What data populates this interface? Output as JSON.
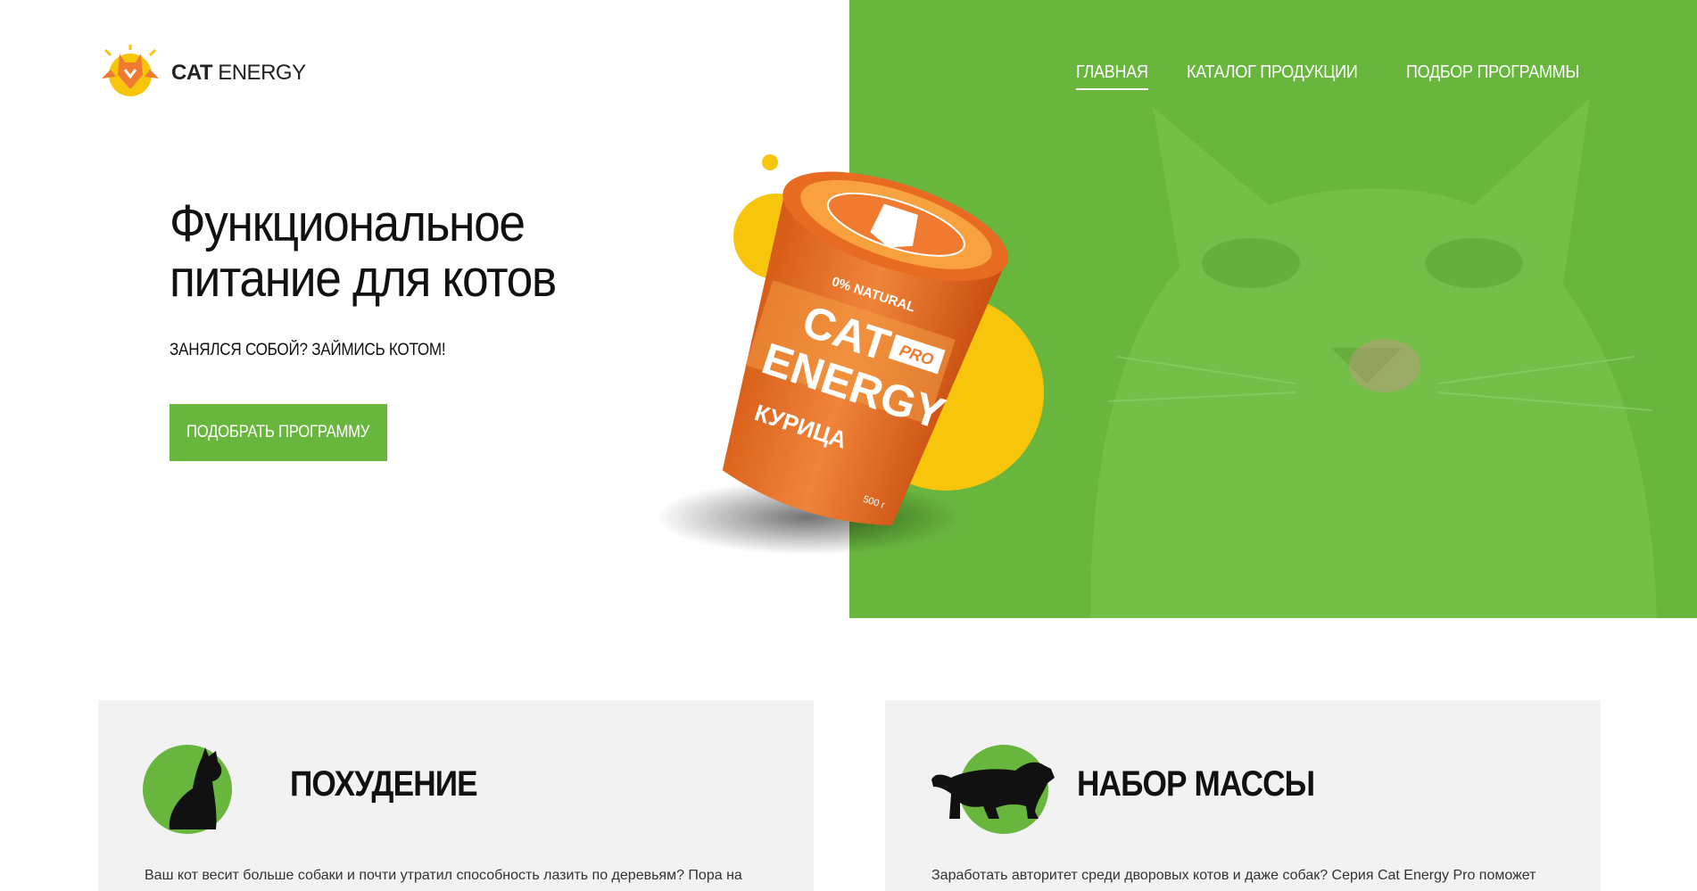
{
  "brand": {
    "name_bold": "CAT",
    "name_light": "ENERGY"
  },
  "nav": {
    "items": [
      {
        "label": "ГЛАВНАЯ",
        "active": true
      },
      {
        "label": "КАТАЛОГ ПРОДУКЦИИ",
        "active": false
      },
      {
        "label": "ПОДБОР ПРОГРАММЫ",
        "active": false
      }
    ]
  },
  "hero": {
    "title": "Функциональное питание для котов",
    "subtitle": "ЗАНЯЛСЯ СОБОЙ? ЗАЙМИСЬ КОТОМ!",
    "cta_label": "ПОДОБРАТЬ ПРОГРАММУ"
  },
  "product": {
    "brand_line1": "CAT",
    "brand_line2": "ENERGY",
    "tag": "PRO",
    "natural": "0% NATURAL",
    "flavor": "КУРИЦА",
    "weight": "500 г"
  },
  "cards": [
    {
      "title": "ПОХУДЕНИЕ",
      "icon": "sitting-cat-icon",
      "text": "Ваш кот весит больше собаки и почти утратил способность лазить по деревьям? Пора на"
    },
    {
      "title": "НАБОР МАССЫ",
      "icon": "panther-icon",
      "text": "Заработать авторитет среди дворовых котов и даже собак? Серия Cat Energy Pro поможет"
    }
  ],
  "colors": {
    "accent": "#68b63d",
    "yellow": "#f7c50c",
    "orange": "#ef7a30",
    "card_bg": "#f2f2f2"
  }
}
